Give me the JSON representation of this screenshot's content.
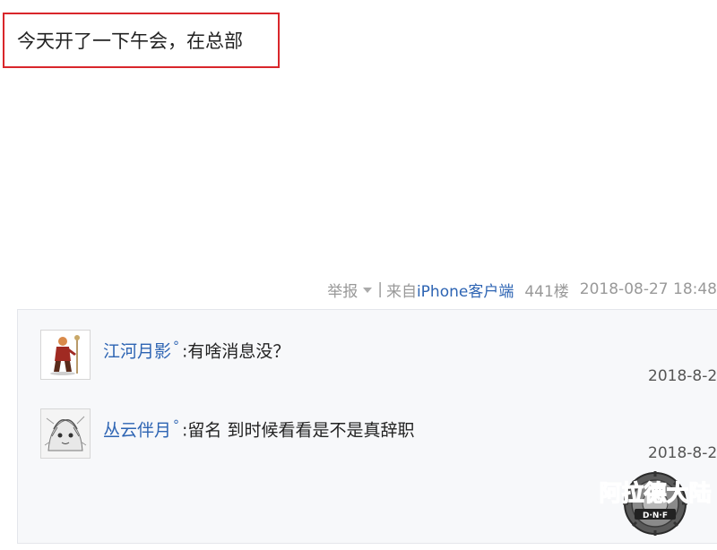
{
  "post": {
    "text": "今天开了一下午会，在总部"
  },
  "post_tail": {
    "report_label": "举报",
    "separator": "|",
    "source_prefix": "来自",
    "source_link": "iPhone客户端",
    "floor": "441楼",
    "datetime": "2018-08-27 18:48"
  },
  "replies": [
    {
      "username": "江河月影",
      "badge": "°",
      "colon": ":",
      "text": "有啥消息没？",
      "time": "2018-8-2"
    },
    {
      "username": "丛云伴月",
      "badge": "°",
      "colon": ":",
      "text": "留名 到时候看看是不是真辞职",
      "time": "2018-8-2"
    }
  ],
  "watermark": {
    "text": "阿拉德大陆",
    "sub": "D·N·F"
  },
  "colors": {
    "highlight_border": "#d9262b",
    "link_blue": "#2d64b3",
    "meta_gray": "#999999",
    "panel_bg": "#f7f8fa"
  }
}
